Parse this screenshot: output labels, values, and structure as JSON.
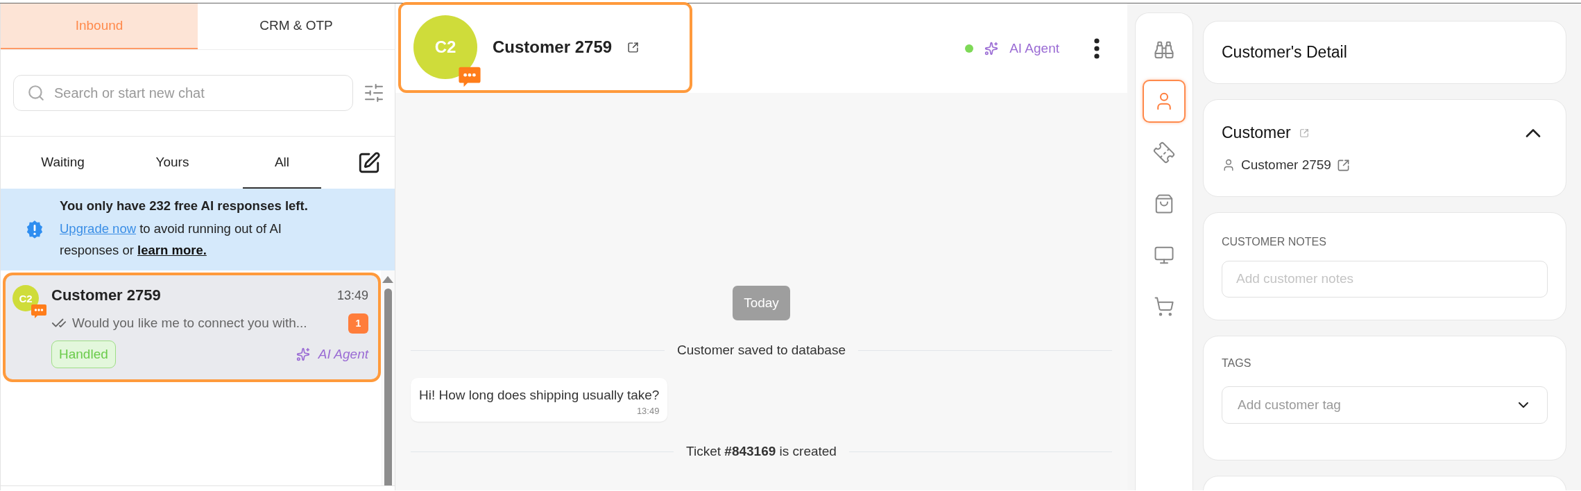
{
  "left_panel": {
    "tabs": [
      {
        "label": "Inbound",
        "selected": true
      },
      {
        "label": "CRM & OTP",
        "selected": false
      }
    ],
    "search": {
      "placeholder": "Search or start new chat"
    },
    "filter_tabs": [
      {
        "label": "Waiting",
        "selected": false
      },
      {
        "label": "Yours",
        "selected": false
      },
      {
        "label": "All",
        "selected": true
      }
    ],
    "banner": {
      "title": "You only have 232 free AI responses left.",
      "link": "Upgrade now",
      "text": " to avoid running out of AI responses or ",
      "link_2": "learn more."
    },
    "chats": [
      {
        "avatar": "C2",
        "name": "Customer 2759",
        "time": "13:49",
        "preview": "Would you like me to connect you with...",
        "unread": "1",
        "status": "Handled",
        "agent": "AI Agent",
        "selected": true,
        "highlighted": true
      }
    ]
  },
  "conversation": {
    "header": {
      "avatar": "C2",
      "name": "Customer 2759",
      "online": true,
      "agent": "AI Agent",
      "highlighted": true
    },
    "messages": [
      {
        "kind": "date",
        "text": "Today"
      },
      {
        "kind": "event",
        "text": "Customer saved to database"
      },
      {
        "kind": "incoming",
        "text": "Hi! How long does shipping usually take?",
        "time": "13:49"
      },
      {
        "kind": "event",
        "text": "Ticket **#843169** is created"
      }
    ]
  },
  "details": {
    "rail": [
      {
        "kind": "binoculars",
        "selected": false
      },
      {
        "kind": "person",
        "selected": true
      },
      {
        "kind": "ticket",
        "selected": false
      },
      {
        "kind": "bag",
        "selected": false
      },
      {
        "kind": "monitor",
        "selected": false
      },
      {
        "kind": "cart",
        "selected": false
      }
    ],
    "title": "Customer's Detail",
    "customer": {
      "heading": "Customer",
      "expanded": true,
      "name": "Customer 2759"
    },
    "notes": {
      "label": "CUSTOMER NOTES",
      "placeholder": "Add customer notes"
    },
    "tags": {
      "label": "TAGS",
      "placeholder": "Add customer tag"
    }
  }
}
